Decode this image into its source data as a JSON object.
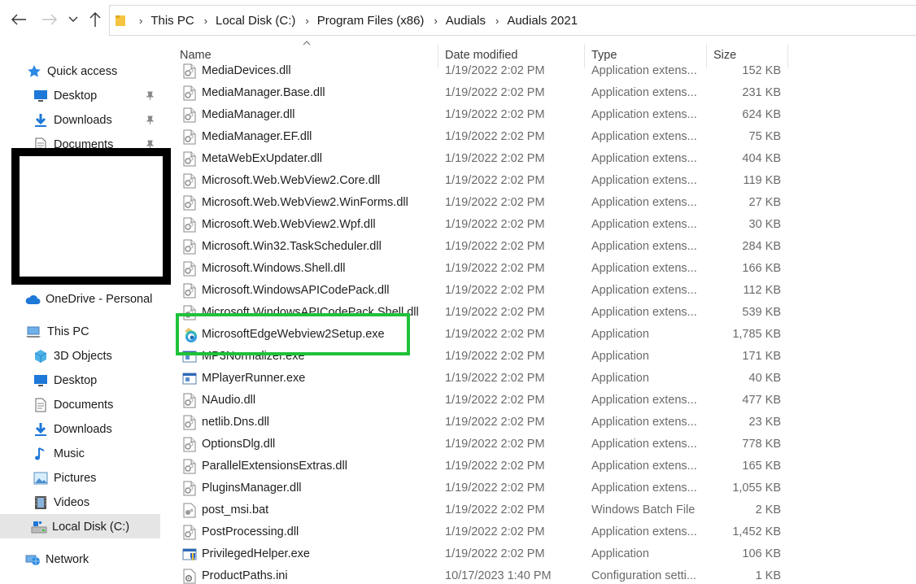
{
  "breadcrumb": [
    "This PC",
    "Local Disk (C:)",
    "Program Files (x86)",
    "Audials",
    "Audials 2021"
  ],
  "sidebar": {
    "items": [
      {
        "label": "Quick access",
        "icon": "star-icon",
        "top": 0
      },
      {
        "label": "Desktop",
        "icon": "desktop-icon",
        "pinned": true
      },
      {
        "label": "Downloads",
        "icon": "downloads-icon",
        "pinned": true
      },
      {
        "label": "Documents",
        "icon": "documents-icon",
        "pinned": true
      },
      {
        "label": "OneDrive - Personal",
        "icon": "cloud-icon"
      },
      {
        "label": "This PC",
        "icon": "computer-icon"
      },
      {
        "label": "3D Objects",
        "icon": "cube-icon"
      },
      {
        "label": "Desktop",
        "icon": "desktop-icon"
      },
      {
        "label": "Documents",
        "icon": "documents-icon"
      },
      {
        "label": "Downloads",
        "icon": "downloads-icon"
      },
      {
        "label": "Music",
        "icon": "music-icon"
      },
      {
        "label": "Pictures",
        "icon": "pictures-icon"
      },
      {
        "label": "Videos",
        "icon": "videos-icon"
      },
      {
        "label": "Local Disk (C:)",
        "icon": "drive-icon",
        "selected": true
      },
      {
        "label": "Network",
        "icon": "network-icon"
      }
    ]
  },
  "columns": {
    "name": "Name",
    "date": "Date modified",
    "type": "Type",
    "size": "Size"
  },
  "files": [
    {
      "name": "MediaDevices.dll",
      "date": "1/19/2022 2:02 PM",
      "type": "Application extens...",
      "size": "152 KB",
      "icon": "dll-icon"
    },
    {
      "name": "MediaManager.Base.dll",
      "date": "1/19/2022 2:02 PM",
      "type": "Application extens...",
      "size": "231 KB",
      "icon": "dll-icon"
    },
    {
      "name": "MediaManager.dll",
      "date": "1/19/2022 2:02 PM",
      "type": "Application extens...",
      "size": "624 KB",
      "icon": "dll-icon"
    },
    {
      "name": "MediaManager.EF.dll",
      "date": "1/19/2022 2:02 PM",
      "type": "Application extens...",
      "size": "75 KB",
      "icon": "dll-icon"
    },
    {
      "name": "MetaWebExUpdater.dll",
      "date": "1/19/2022 2:02 PM",
      "type": "Application extens...",
      "size": "404 KB",
      "icon": "dll-icon"
    },
    {
      "name": "Microsoft.Web.WebView2.Core.dll",
      "date": "1/19/2022 2:02 PM",
      "type": "Application extens...",
      "size": "119 KB",
      "icon": "dll-icon"
    },
    {
      "name": "Microsoft.Web.WebView2.WinForms.dll",
      "date": "1/19/2022 2:02 PM",
      "type": "Application extens...",
      "size": "27 KB",
      "icon": "dll-icon"
    },
    {
      "name": "Microsoft.Web.WebView2.Wpf.dll",
      "date": "1/19/2022 2:02 PM",
      "type": "Application extens...",
      "size": "30 KB",
      "icon": "dll-icon"
    },
    {
      "name": "Microsoft.Win32.TaskScheduler.dll",
      "date": "1/19/2022 2:02 PM",
      "type": "Application extens...",
      "size": "284 KB",
      "icon": "dll-icon"
    },
    {
      "name": "Microsoft.Windows.Shell.dll",
      "date": "1/19/2022 2:02 PM",
      "type": "Application extens...",
      "size": "166 KB",
      "icon": "dll-icon"
    },
    {
      "name": "Microsoft.WindowsAPICodePack.dll",
      "date": "1/19/2022 2:02 PM",
      "type": "Application extens...",
      "size": "112 KB",
      "icon": "dll-icon"
    },
    {
      "name": "Microsoft.WindowsAPICodePack.Shell.dll",
      "date": "1/19/2022 2:02 PM",
      "type": "Application extens...",
      "size": "539 KB",
      "icon": "dll-icon"
    },
    {
      "name": "MicrosoftEdgeWebview2Setup.exe",
      "date": "1/19/2022 2:02 PM",
      "type": "Application",
      "size": "1,785 KB",
      "icon": "edge-setup-icon"
    },
    {
      "name": "MP3Normalizer.exe",
      "date": "1/19/2022 2:02 PM",
      "type": "Application",
      "size": "171 KB",
      "icon": "exe-icon"
    },
    {
      "name": "MPlayerRunner.exe",
      "date": "1/19/2022 2:02 PM",
      "type": "Application",
      "size": "40 KB",
      "icon": "exe-icon"
    },
    {
      "name": "NAudio.dll",
      "date": "1/19/2022 2:02 PM",
      "type": "Application extens...",
      "size": "477 KB",
      "icon": "dll-icon"
    },
    {
      "name": "netlib.Dns.dll",
      "date": "1/19/2022 2:02 PM",
      "type": "Application extens...",
      "size": "23 KB",
      "icon": "dll-icon"
    },
    {
      "name": "OptionsDlg.dll",
      "date": "1/19/2022 2:02 PM",
      "type": "Application extens...",
      "size": "778 KB",
      "icon": "dll-icon"
    },
    {
      "name": "ParallelExtensionsExtras.dll",
      "date": "1/19/2022 2:02 PM",
      "type": "Application extens...",
      "size": "165 KB",
      "icon": "dll-icon"
    },
    {
      "name": "PluginsManager.dll",
      "date": "1/19/2022 2:02 PM",
      "type": "Application extens...",
      "size": "1,055 KB",
      "icon": "dll-icon"
    },
    {
      "name": "post_msi.bat",
      "date": "1/19/2022 2:02 PM",
      "type": "Windows Batch File",
      "size": "2 KB",
      "icon": "bat-icon"
    },
    {
      "name": "PostProcessing.dll",
      "date": "1/19/2022 2:02 PM",
      "type": "Application extens...",
      "size": "1,452 KB",
      "icon": "dll-icon"
    },
    {
      "name": "PrivilegedHelper.exe",
      "date": "1/19/2022 2:02 PM",
      "type": "Application",
      "size": "106 KB",
      "icon": "shield-exe-icon"
    },
    {
      "name": "ProductPaths.ini",
      "date": "10/17/2023 1:40 PM",
      "type": "Configuration setti...",
      "size": "1 KB",
      "icon": "ini-icon"
    }
  ],
  "colors": {
    "highlight": "#1fc23a",
    "selected": "#e5e5e5",
    "accent": "#1e78d7"
  }
}
